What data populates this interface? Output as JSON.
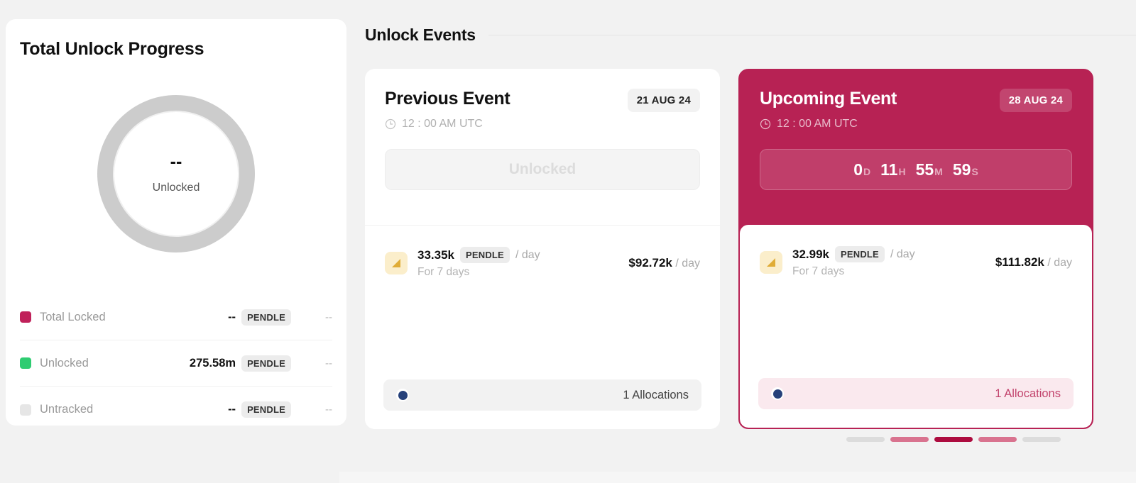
{
  "colors": {
    "background": "#f2f2f2",
    "crimson": "#b72254",
    "crimson_dark": "#ad0c3f",
    "pink_light": "#d9738f",
    "gray_bar": "#dcdcdc",
    "green": "#2ecc71",
    "navy_dot": "#26417a",
    "gold": "#e0ac36"
  },
  "progress_panel": {
    "title": "Total Unlock Progress",
    "donut": {
      "value": "--",
      "label": "Unlocked"
    },
    "legend": [
      {
        "name": "Total Locked",
        "color": "#c0215a",
        "amount": "--",
        "unit": "PENDLE",
        "percent": "--"
      },
      {
        "name": "Unlocked",
        "color": "#2ecc71",
        "amount": "275.58m",
        "unit": "PENDLE",
        "percent": "--"
      },
      {
        "name": "Untracked",
        "color": "#e6e6e6",
        "amount": "--",
        "unit": "PENDLE",
        "percent": "--"
      }
    ]
  },
  "events": {
    "section_title": "Unlock Events",
    "previous": {
      "title": "Previous Event",
      "date_badge": "21 AUG 24",
      "time": "12 : 00 AM UTC",
      "state_label": "Unlocked",
      "allocation": {
        "amount": "33.35k",
        "unit": "PENDLE",
        "per": "/ day",
        "duration": "For 7 days",
        "usd_amount": "$92.72k",
        "usd_per": "/ day"
      },
      "footer_count": "1 Allocations"
    },
    "upcoming": {
      "title": "Upcoming Event",
      "date_badge": "28 AUG 24",
      "time": "12 : 00 AM UTC",
      "countdown": [
        {
          "num": "0",
          "unit": "D"
        },
        {
          "num": "11",
          "unit": "H"
        },
        {
          "num": "55",
          "unit": "M"
        },
        {
          "num": "59",
          "unit": "S"
        }
      ],
      "allocation": {
        "amount": "32.99k",
        "unit": "PENDLE",
        "per": "/ day",
        "duration": "For 7 days",
        "usd_amount": "$111.82k",
        "usd_per": "/ day"
      },
      "footer_count": "1 Allocations"
    },
    "pager": [
      {
        "color": "#dcdcdc"
      },
      {
        "color": "#d9738f"
      },
      {
        "color": "#ad0c3f"
      },
      {
        "color": "#d9738f"
      },
      {
        "color": "#dcdcdc"
      }
    ]
  }
}
